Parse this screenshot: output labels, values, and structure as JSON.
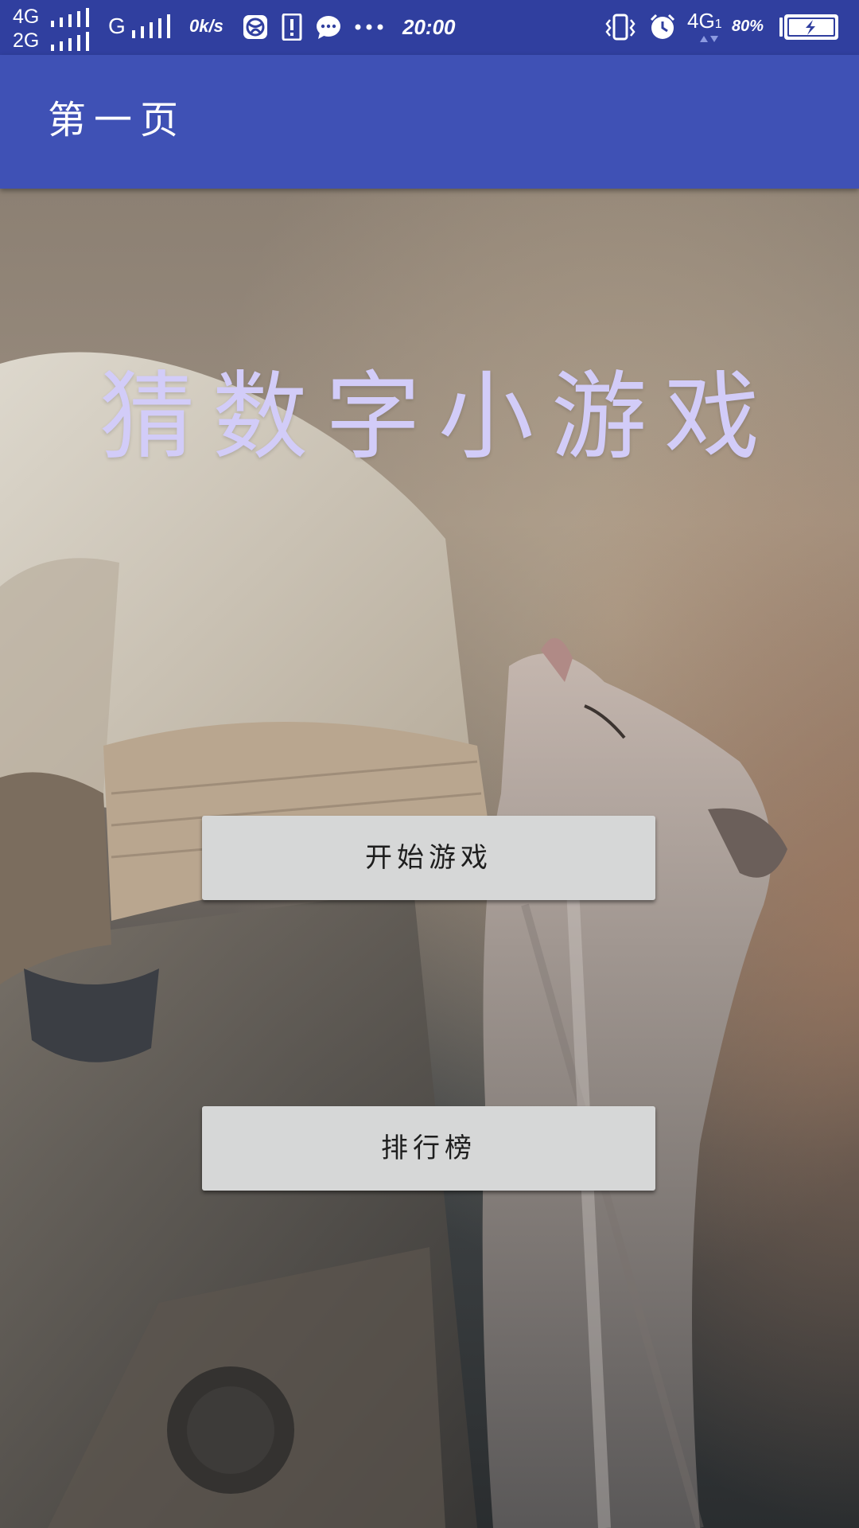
{
  "status_bar": {
    "network_top": "4G",
    "network_bottom": "2G",
    "network_mid": "G",
    "speed": "0k/s",
    "time": "20:00",
    "network_right": "4G",
    "network_right_sub": "1",
    "battery_percent": "80",
    "icons": [
      "browser-icon",
      "alert-icon",
      "message-icon",
      "more-dots-icon",
      "vibrate-icon",
      "alarm-icon",
      "battery-charging-icon"
    ],
    "background_color": "#303f9f"
  },
  "app_bar": {
    "title": "第一页",
    "background_color": "#3f51b5"
  },
  "main": {
    "game_title": "猜数字小游戏",
    "game_title_color": "#d2ccf8",
    "start_button_label": "开始游戏",
    "ranking_button_label": "排行榜",
    "button_color": "#d6d7d7"
  }
}
